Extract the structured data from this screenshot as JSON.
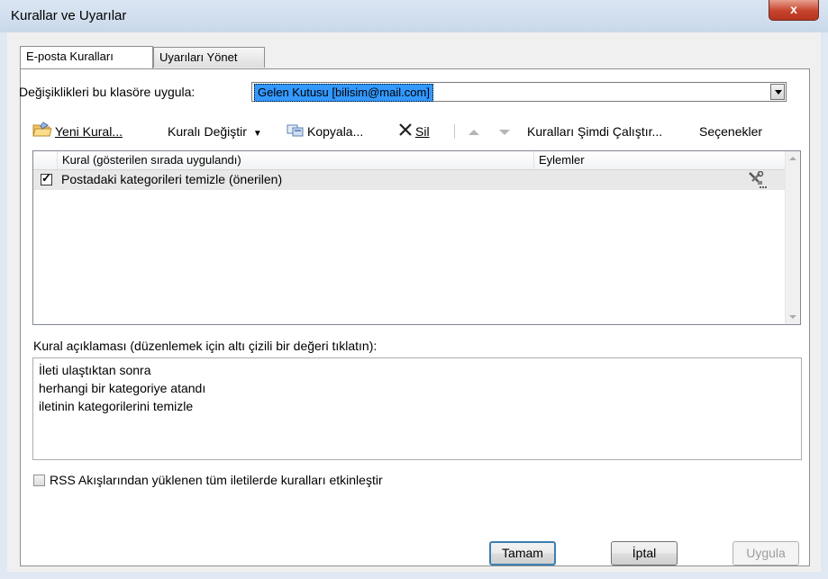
{
  "window": {
    "title": "Kurallar ve Uyarılar",
    "close_glyph": "x"
  },
  "tabs": [
    {
      "label": "E-posta Kuralları",
      "active": true
    },
    {
      "label": "Uyarıları Yönet",
      "active": false
    }
  ],
  "folder": {
    "label": "Değişiklikleri bu klasöre uygula:",
    "value": "Gelen Kutusu [bilisim@mail.com]"
  },
  "toolbar": {
    "new_rule": "Yeni Kural...",
    "change_rule": "Kuralı Değiştir",
    "copy": "Kopyala...",
    "delete": "Sil",
    "run_rules": "Kuralları Şimdi Çalıştır...",
    "options": "Seçenekler"
  },
  "grid": {
    "columns": [
      "Kural (gösterilen sırada uygulandı)",
      "Eylemler"
    ],
    "rows": [
      {
        "checked": true,
        "name": "Postadaki kategorileri temizle (önerilen)",
        "action_icon": "wrench-tools-icon"
      }
    ]
  },
  "description": {
    "label": "Kural açıklaması (düzenlemek için altı çizili bir değeri tıklatın):",
    "lines": [
      "İleti ulaştıktan sonra",
      "herhangi bir kategoriye atandı",
      "iletinin kategorilerini temizle"
    ]
  },
  "rss_option": {
    "label": "RSS Akışlarından yüklenen tüm iletilerde kuralları etkinleştir",
    "checked": false
  },
  "buttons": {
    "ok": "Tamam",
    "cancel": "İptal",
    "apply": "Uygula"
  },
  "colors": {
    "selection": "#3399ff",
    "row_highlight": "#e8e8e8"
  }
}
